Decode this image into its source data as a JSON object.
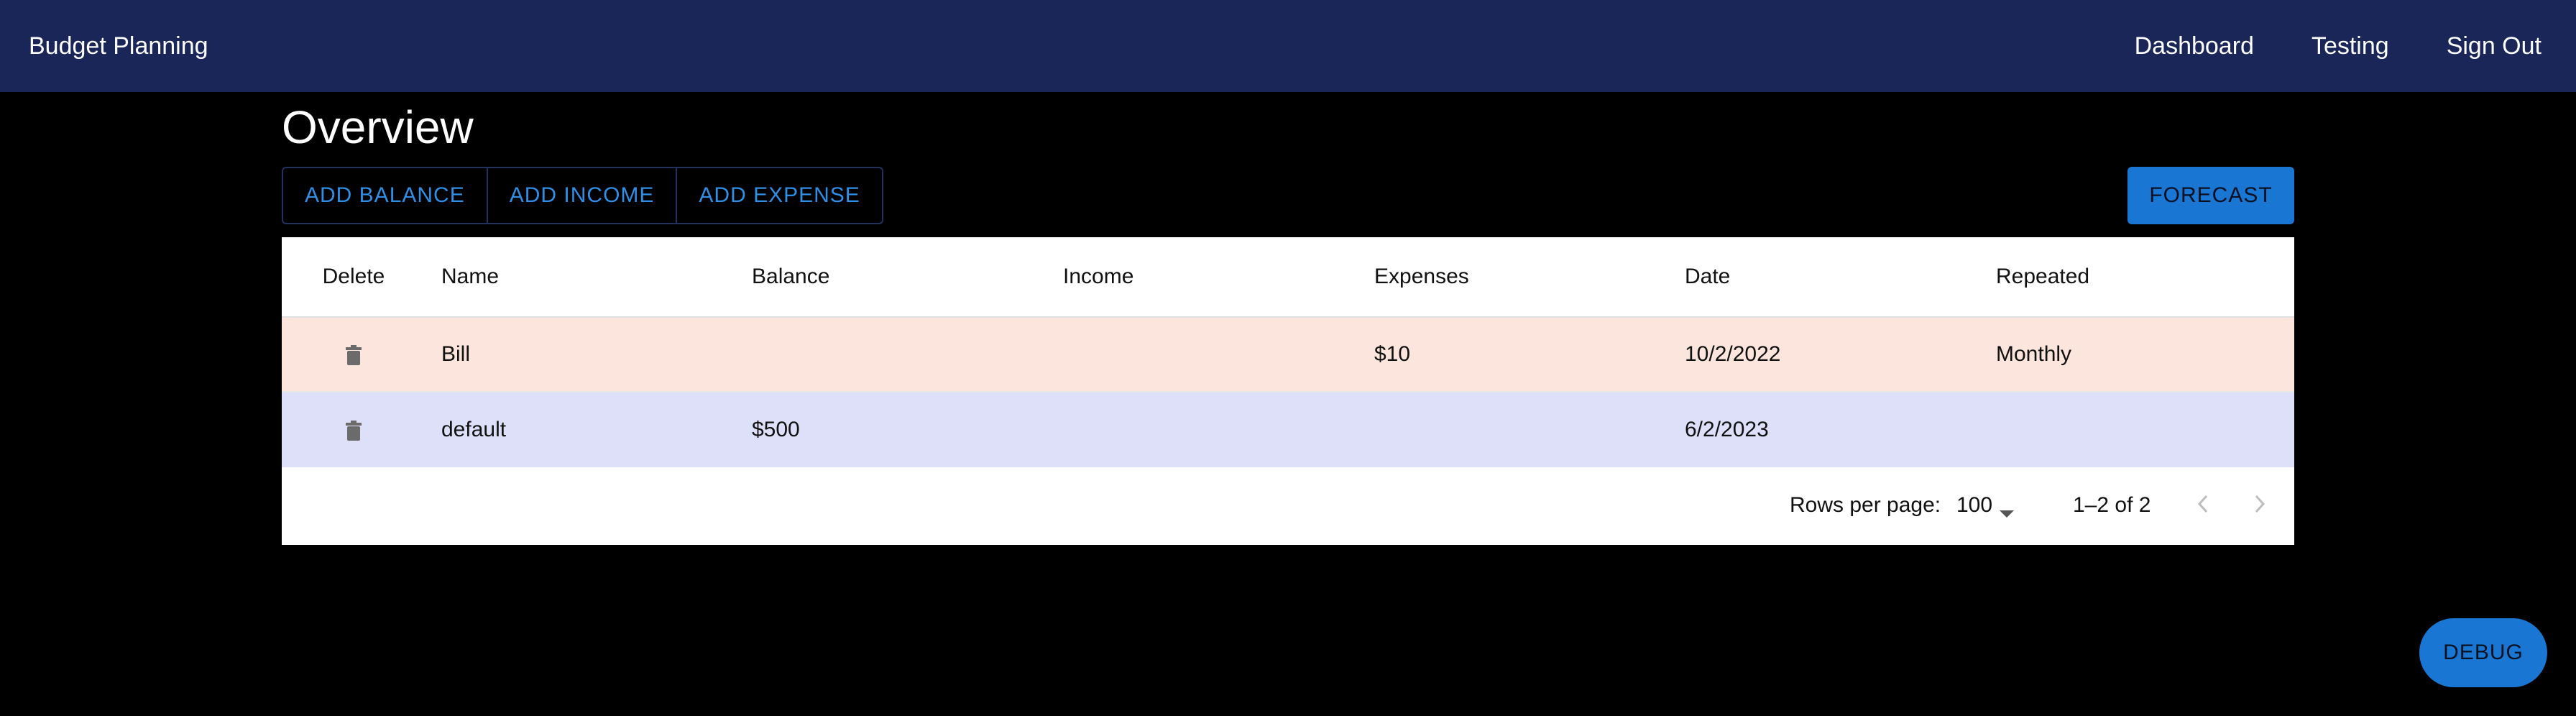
{
  "appbar": {
    "brand": "Budget Planning",
    "nav": [
      "Dashboard",
      "Testing",
      "Sign Out"
    ]
  },
  "page": {
    "title": "Overview"
  },
  "actions": {
    "add_balance": "ADD BALANCE",
    "add_income": "ADD INCOME",
    "add_expense": "ADD EXPENSE",
    "forecast": "FORECAST"
  },
  "table": {
    "columns": [
      "Delete",
      "Name",
      "Balance",
      "Income",
      "Expenses",
      "Date",
      "Repeated"
    ],
    "rows": [
      {
        "name": "Bill",
        "balance": "",
        "income": "",
        "expenses": "$10",
        "date": "10/2/2022",
        "repeated": "Monthly",
        "color": "#fbe5dc"
      },
      {
        "name": "default",
        "balance": "$500",
        "income": "",
        "expenses": "",
        "date": "6/2/2023",
        "repeated": "",
        "color": "#dde0f8"
      }
    ]
  },
  "pagination": {
    "rows_per_page_label": "Rows per page:",
    "rows_per_page_value": "100",
    "range": "1–2 of 2"
  },
  "debug": {
    "label": "DEBUG"
  },
  "colors": {
    "appbar": "#1a2658",
    "accent": "#1976d2",
    "outlined_text": "#2f8fe6"
  },
  "icons": {
    "delete": "trash-icon",
    "dropdown": "caret-down-icon",
    "prev": "chevron-left-icon",
    "next": "chevron-right-icon"
  }
}
